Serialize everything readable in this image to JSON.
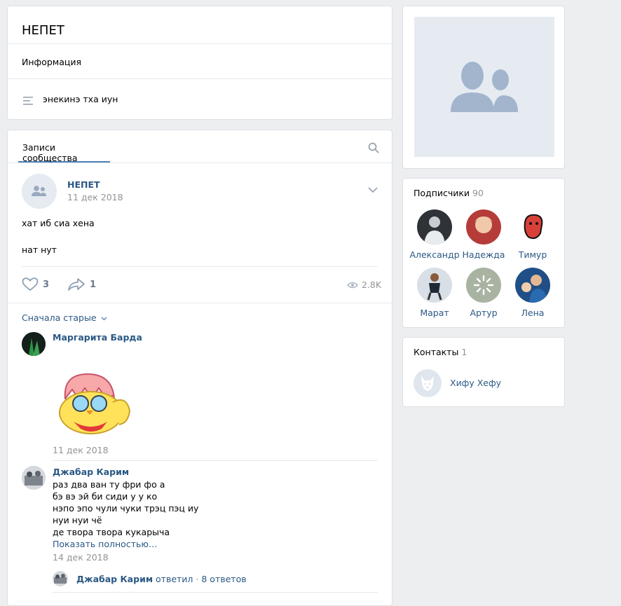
{
  "header": {
    "title": "НЕПЕТ",
    "info_label": "Информация",
    "status": "энекинэ тха иун"
  },
  "wall": {
    "tab_label": "Записи сообщества",
    "post": {
      "author": "НЕПЕТ",
      "date": "11 дек 2018",
      "line1": "хат иб сиа хена",
      "line2": "нат нут",
      "likes": "3",
      "shares": "1",
      "views": "2.8K"
    },
    "sort_label": "Сначала старые",
    "comments": [
      {
        "author": "Маргарита Барда",
        "date": "11 дек 2018"
      },
      {
        "author": "Джабар Карим",
        "lines": [
          "раз два ван ту фри фо а",
          "бэ вэ эй би сиди у у ко",
          "нэпо эпо чули чуки трэц пэц иу",
          "нуи нуи чё",
          "де твора твора кукарыча"
        ],
        "show_more": "Показать полностью…",
        "date": "14 дек 2018",
        "reply_author": "Джабар Карим",
        "reply_verb": "ответил",
        "reply_dot": "·",
        "reply_count": "8 ответов"
      }
    ]
  },
  "subscribers": {
    "title": "Подписчики",
    "count": "90",
    "people": [
      {
        "name": "Александр"
      },
      {
        "name": "Надежда"
      },
      {
        "name": "Тимур"
      },
      {
        "name": "Марат"
      },
      {
        "name": "Артур"
      },
      {
        "name": "Лена"
      }
    ]
  },
  "contacts": {
    "title": "Контакты",
    "count": "1",
    "person": "Хифу Хефу"
  },
  "colors": {
    "link": "#2a5885",
    "accent": "#5181b8",
    "background": "#edeef0"
  }
}
